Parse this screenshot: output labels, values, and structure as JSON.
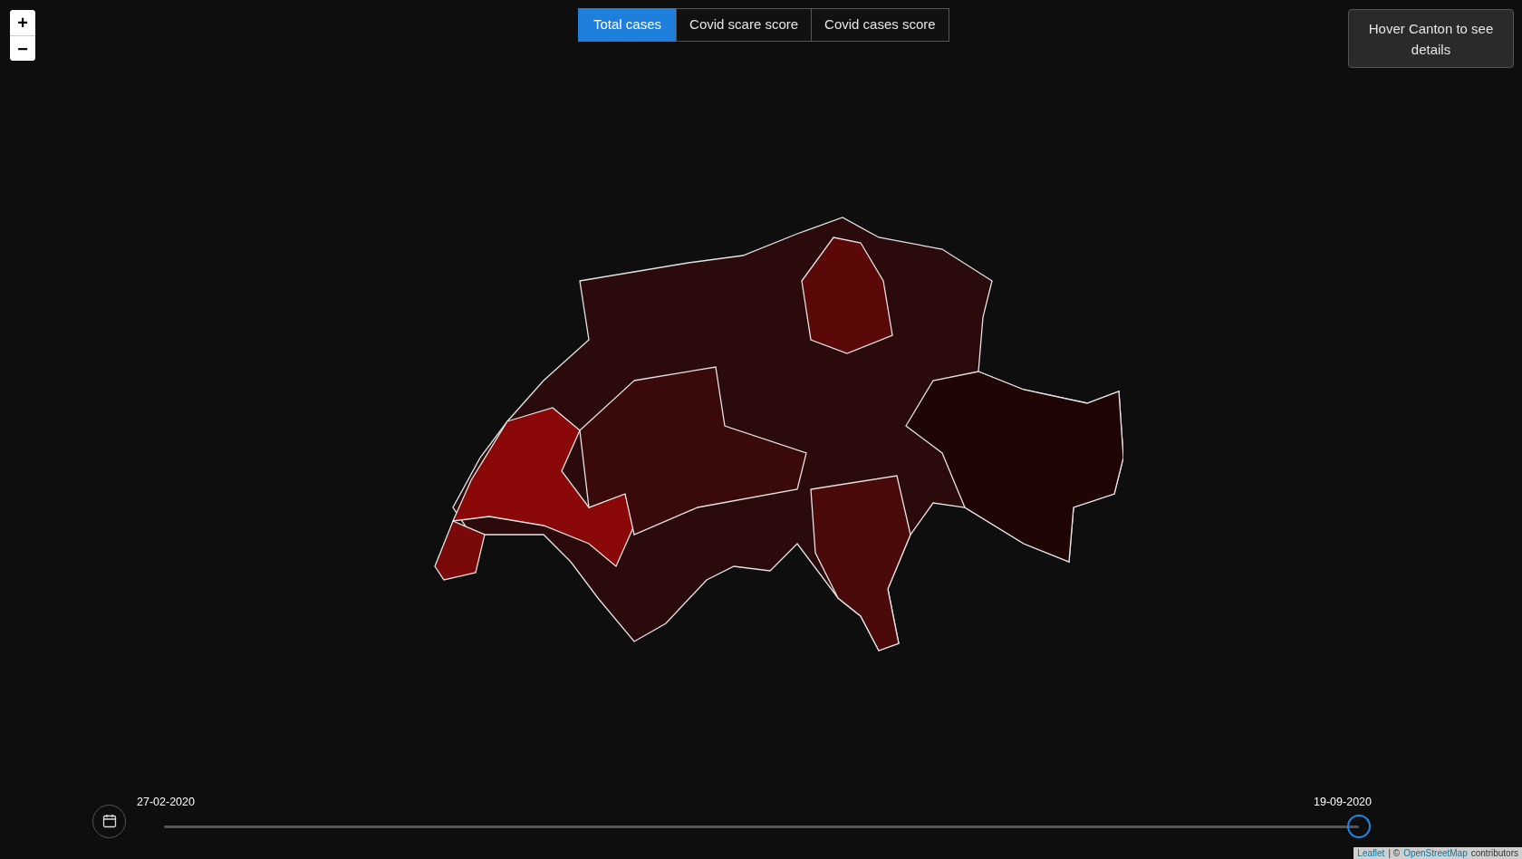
{
  "zoom_controls": [
    {
      "label": "+"
    },
    {
      "label": "−"
    }
  ],
  "tabs": [
    {
      "label": "Total cases",
      "selected": true
    },
    {
      "label": "Covid scare score",
      "selected": false
    },
    {
      "label": "Covid cases score",
      "selected": false
    }
  ],
  "info_panel": {
    "text": "Hover Canton to see details"
  },
  "timeline": {
    "start_date": "27-02-2020",
    "end_date": "19-09-2020",
    "level": 1
  },
  "attribution": {
    "library_link": "Leaflet",
    "separator": "| ©",
    "map_link": "OpenStreetMap",
    "suffix": "contributors"
  }
}
